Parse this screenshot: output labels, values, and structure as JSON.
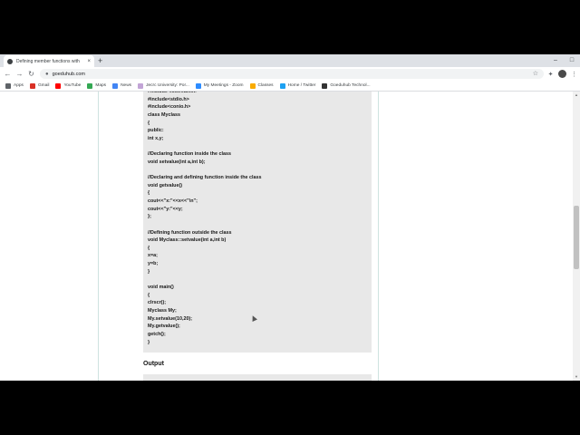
{
  "tab": {
    "title": "Defining member functions with",
    "close": "×",
    "new_tab": "+"
  },
  "window_controls": {
    "minimize": "–",
    "maximize": "□",
    "close": "×"
  },
  "toolbar": {
    "back": "←",
    "forward": "→",
    "reload": "↻",
    "lock": "🔒",
    "url": "goeduhub.com",
    "star": "☆",
    "extensions": "✦",
    "menu": "⋮"
  },
  "bookmarks": [
    {
      "label": "Apps",
      "color": "#5f6368"
    },
    {
      "label": "Gmail",
      "color": "#d93025"
    },
    {
      "label": "YouTube",
      "color": "#ff0000"
    },
    {
      "label": "Maps",
      "color": "#34a853"
    },
    {
      "label": "News",
      "color": "#4285f4"
    },
    {
      "label": "Jecrc University: Por...",
      "color": "#c2a4d6"
    },
    {
      "label": "My Meetings - Zoom",
      "color": "#2d8cff"
    },
    {
      "label": "Classes",
      "color": "#f9ab00"
    },
    {
      "label": "Home / Twitter",
      "color": "#1da1f2"
    },
    {
      "label": "Goeduhub Technol...",
      "color": "#333333"
    }
  ],
  "code_lines": [
    "#include<iostream.h>",
    "#include<stdio.h>",
    "#include<conio.h>",
    "class Myclass",
    "{",
    "public:",
    "int x,y;",
    "",
    "//Declaring function inside the class",
    "void setvalue(int a,int b);",
    "",
    "//Declaring and defining function inside the class",
    "void getvalue()",
    "{",
    "cout<<\"x:\"<<x<<\"\\n\";",
    "cout<<\"y:\"<<y;",
    "};",
    "",
    "//Defining function outside the class",
    "void Myclass::setvalue(int a,int b)",
    "{",
    "x=a;",
    "y=b;",
    "}",
    "",
    "void main()",
    "{",
    "clrscr();",
    "Myclass My;",
    "My.setvalue(10,20);",
    "My.getvalue();",
    "getch();",
    "}"
  ],
  "output_heading": "Output",
  "scrollbar": {
    "up": "▲",
    "down": "▼"
  }
}
